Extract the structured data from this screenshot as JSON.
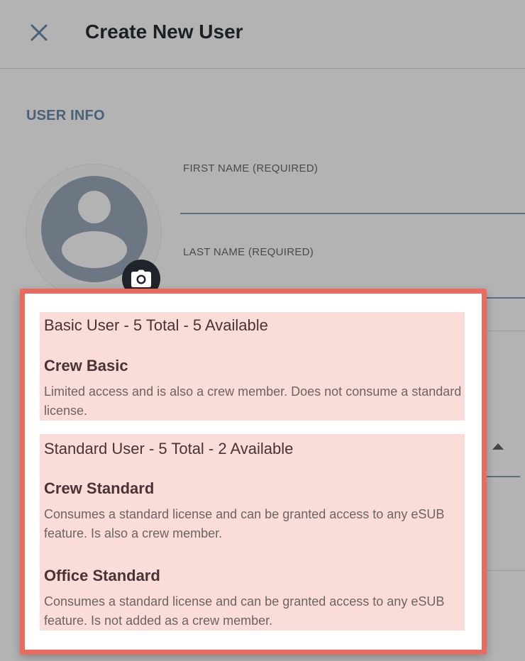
{
  "header": {
    "title": "Create New User",
    "close_icon": "close-icon"
  },
  "section": {
    "title": "USER INFO"
  },
  "avatar": {
    "icon": "person-icon",
    "camera_icon": "camera-icon"
  },
  "fields": {
    "first_name_label": "FIRST NAME (REQUIRED)",
    "first_name_value": "",
    "last_name_label": "LAST NAME (REQUIRED)",
    "last_name_value": ""
  },
  "dropdown": {
    "groups": [
      {
        "header": "Basic User - 5 Total - 5 Available",
        "options": [
          {
            "title": "Crew Basic",
            "description": "Limited access and is also a crew member. Does not consume a standard license."
          }
        ]
      },
      {
        "header": "Standard User - 5 Total - 2 Available",
        "options": [
          {
            "title": "Crew Standard",
            "description": "Consumes a standard license and can be granted access to any eSUB feature. Is also a crew member."
          },
          {
            "title": "Office Standard",
            "description": "Consumes a standard license and can be granted access to any eSUB feature. Is not added as a crew member."
          }
        ]
      }
    ]
  },
  "colors": {
    "overlay": "#b3b3b3",
    "accent_border": "#ea6a5d",
    "group_bg": "#fadcd9",
    "section_title": "#4b6179"
  }
}
